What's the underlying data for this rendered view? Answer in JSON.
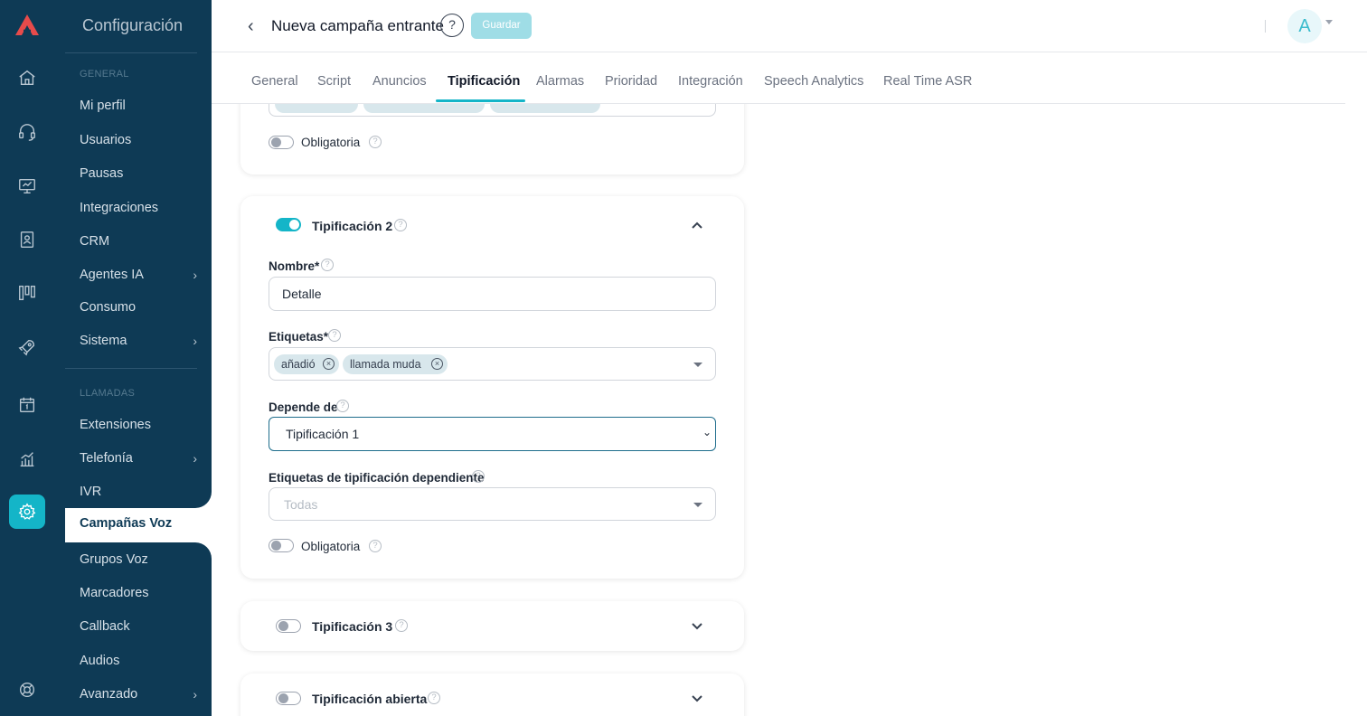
{
  "sidebar": {
    "title": "Configuración",
    "section_general": "GENERAL",
    "section_calls": "LLAMADAS",
    "general_items": [
      {
        "label": "Mi perfil",
        "chevron": ""
      },
      {
        "label": "Usuarios",
        "chevron": ""
      },
      {
        "label": "Pausas",
        "chevron": ""
      },
      {
        "label": "Integraciones",
        "chevron": ""
      },
      {
        "label": "CRM",
        "chevron": ""
      },
      {
        "label": "Agentes IA",
        "chevron": "›"
      },
      {
        "label": "Consumo",
        "chevron": ""
      },
      {
        "label": "Sistema",
        "chevron": "›"
      }
    ],
    "call_items": [
      {
        "label": "Extensiones",
        "chevron": ""
      },
      {
        "label": "Telefonía",
        "chevron": "›"
      },
      {
        "label": "IVR",
        "chevron": ""
      },
      {
        "label": "Campañas Voz",
        "chevron": "",
        "active": true
      },
      {
        "label": "Grupos Voz",
        "chevron": ""
      },
      {
        "label": "Marcadores",
        "chevron": ""
      },
      {
        "label": "Callback",
        "chevron": ""
      },
      {
        "label": "Audios",
        "chevron": ""
      },
      {
        "label": "Avanzado",
        "chevron": "›"
      }
    ]
  },
  "rail_icons": [
    "home-icon",
    "headset-icon",
    "monitor-icon",
    "contacts-icon",
    "board-icon",
    "rocket-icon",
    "calendar-icon",
    "analytics-icon",
    "settings-icon",
    "support-icon"
  ],
  "header": {
    "back_icon": "‹",
    "title": "Nueva campaña entrante",
    "help": "?",
    "save_label": "Guardar",
    "avatar_letter": "A"
  },
  "tabs": [
    "General",
    "Script",
    "Anuncios",
    "Tipificación",
    "Alarmas",
    "Prioridad",
    "Integración",
    "Speech Analytics",
    "Real Time ASR"
  ],
  "active_tab": "Tipificación",
  "card1": {
    "mandatory_label": "Obligatoria",
    "mandatory_on": false
  },
  "card2": {
    "title": "Tipificación 2",
    "enabled": true,
    "name_label": "Nombre*",
    "name_value": "Detalle",
    "tags_label": "Etiquetas*",
    "tags": [
      "añadió",
      "llamada muda"
    ],
    "depends_label": "Depende de",
    "depends_value": "Tipificación 1",
    "dep_tags_label": "Etiquetas de tipificación dependiente",
    "dep_tags_placeholder": "Todas",
    "mandatory_label": "Obligatoria",
    "mandatory_on": false
  },
  "card3": {
    "title": "Tipificación 3",
    "enabled": false
  },
  "card4": {
    "title": "Tipificación abierta",
    "enabled": false
  },
  "colors": {
    "sidebar_bg": "#0e3a55",
    "accent": "#14b5c8",
    "save_button_disabled": "#9fdde6"
  }
}
